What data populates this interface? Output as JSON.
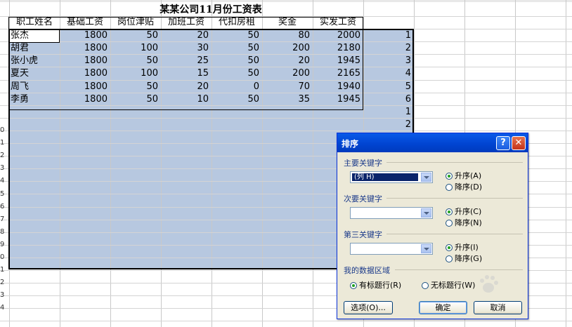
{
  "sheet": {
    "title": "某某公司11月份工资表",
    "headers": [
      "职工姓名",
      "基础工资",
      "岗位津贴",
      "加班工资",
      "代扣房租",
      "奖金",
      "实发工资"
    ],
    "rows": [
      [
        "张杰",
        "1800",
        "50",
        "20",
        "50",
        "80",
        "2000"
      ],
      [
        "胡君",
        "1800",
        "100",
        "30",
        "50",
        "200",
        "2180"
      ],
      [
        "张小虎",
        "1800",
        "50",
        "25",
        "50",
        "20",
        "1945"
      ],
      [
        "夏天",
        "1800",
        "100",
        "15",
        "50",
        "200",
        "2165"
      ],
      [
        "周飞",
        "1800",
        "50",
        "20",
        "0",
        "70",
        "1940"
      ],
      [
        "李勇",
        "1800",
        "50",
        "10",
        "50",
        "35",
        "1945"
      ]
    ],
    "index_column": [
      "1",
      "2",
      "3",
      "4",
      "5",
      "6",
      "1",
      "2"
    ],
    "row_header_fragments": [
      "0",
      "1",
      "2",
      "3",
      "4",
      "5",
      "6",
      "7",
      "8",
      "9",
      "0",
      "1",
      "2",
      "3",
      "4"
    ],
    "highlight_color": "#b7c8e0"
  },
  "dialog": {
    "title": "排序",
    "help_label": "?",
    "close_label": "✕",
    "primary_key": {
      "label": "主要关键字",
      "value": "(列 H)",
      "asc": "升序(A)",
      "desc": "降序(D)",
      "selected": "asc"
    },
    "secondary_key": {
      "label": "次要关键字",
      "value": "",
      "asc": "升序(C)",
      "desc": "降序(N)",
      "selected": "asc"
    },
    "third_key": {
      "label": "第三关键字",
      "value": "",
      "asc": "升序(I)",
      "desc": "降序(G)",
      "selected": "asc"
    },
    "data_range": {
      "label": "我的数据区域",
      "has_header": "有标题行(R)",
      "no_header": "无标题行(W)",
      "selected": "has_header"
    },
    "options_label": "选项(O)...",
    "ok_label": "确定",
    "cancel_label": "取消",
    "title_bar_color": "#0a5ae8"
  }
}
